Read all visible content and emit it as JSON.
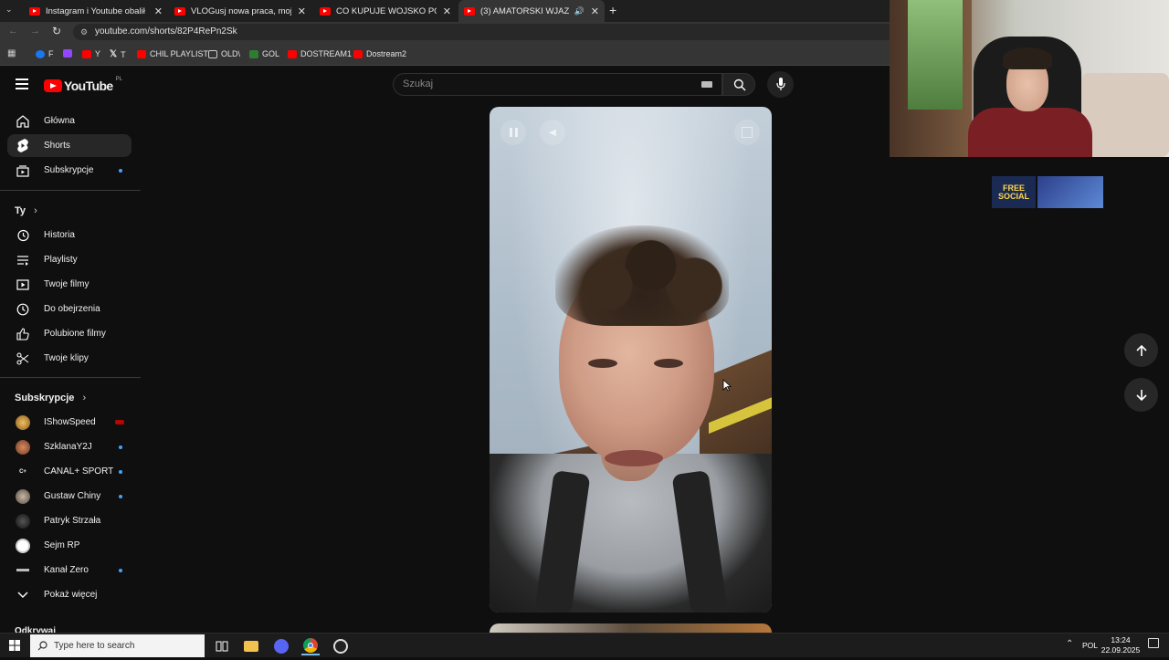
{
  "tabs": [
    {
      "label": "Instagram i Youtube obalił pań",
      "active": false
    },
    {
      "label": "VLOGusj nowa praca, moje prz",
      "active": false
    },
    {
      "label": "CO KUPUJE WOJSKO POLSKIE?",
      "active": false
    },
    {
      "label": "(3) AMATORSKI WJAZD W",
      "active": true
    }
  ],
  "address_bar": {
    "url": "youtube.com/shorts/82P4RePn2Sk"
  },
  "bookmarks": [
    {
      "label": "F",
      "icon": "facebook-icon"
    },
    {
      "label": "",
      "icon": "twitch-icon"
    },
    {
      "label": "Y",
      "icon": "youtube-icon"
    },
    {
      "label": "T",
      "icon": "x-icon"
    },
    {
      "label": "CHIL PLAYLIST",
      "icon": "youtube-icon"
    },
    {
      "label": "OLD\\",
      "icon": "folder-icon"
    },
    {
      "label": "GOL",
      "icon": "gol-icon"
    },
    {
      "label": "DOSTREAM1",
      "icon": "youtube-icon"
    },
    {
      "label": "Dostream2",
      "icon": "youtube-icon"
    }
  ],
  "youtube": {
    "logo_text": "YouTube",
    "country_code": "PL",
    "search_placeholder": "Szukaj"
  },
  "sidebar": {
    "main": [
      {
        "label": "Główna",
        "icon": "home-icon"
      },
      {
        "label": "Shorts",
        "icon": "shorts-icon",
        "active": true
      },
      {
        "label": "Subskrypcje",
        "icon": "subscriptions-icon",
        "dot": true
      }
    ],
    "you_header": "Ty",
    "you_items": [
      {
        "label": "Historia",
        "icon": "history-icon"
      },
      {
        "label": "Playlisty",
        "icon": "playlist-icon"
      },
      {
        "label": "Twoje filmy",
        "icon": "your-videos-icon"
      },
      {
        "label": "Do obejrzenia",
        "icon": "watch-later-icon"
      },
      {
        "label": "Polubione filmy",
        "icon": "liked-icon"
      },
      {
        "label": "Twoje klipy",
        "icon": "clips-icon"
      }
    ],
    "subs_header": "Subskrypcje",
    "subscriptions": [
      {
        "label": "IShowSpeed",
        "live": true
      },
      {
        "label": "SzklanaY2J",
        "dot": true
      },
      {
        "label": "CANAL+ SPORT",
        "dot": true
      },
      {
        "label": "Gustaw Chiny",
        "dot": true
      },
      {
        "label": "Patryk Strzała",
        "dot": false
      },
      {
        "label": "Sejm RP",
        "dot": false
      },
      {
        "label": "Kanał Zero",
        "dot": true
      }
    ],
    "show_more": "Pokaż więcej",
    "explore_header": "Odkrywaj"
  },
  "overlay": {
    "badge_text": "FREE SOCIAL"
  },
  "taskbar": {
    "search_placeholder": "Type here to search",
    "language": "POL",
    "time": "13:24",
    "date": "22.09.2025"
  },
  "colors": {
    "youtube_red": "#ff0000",
    "link_blue": "#3ea6ff",
    "live_red": "#ff0000"
  }
}
